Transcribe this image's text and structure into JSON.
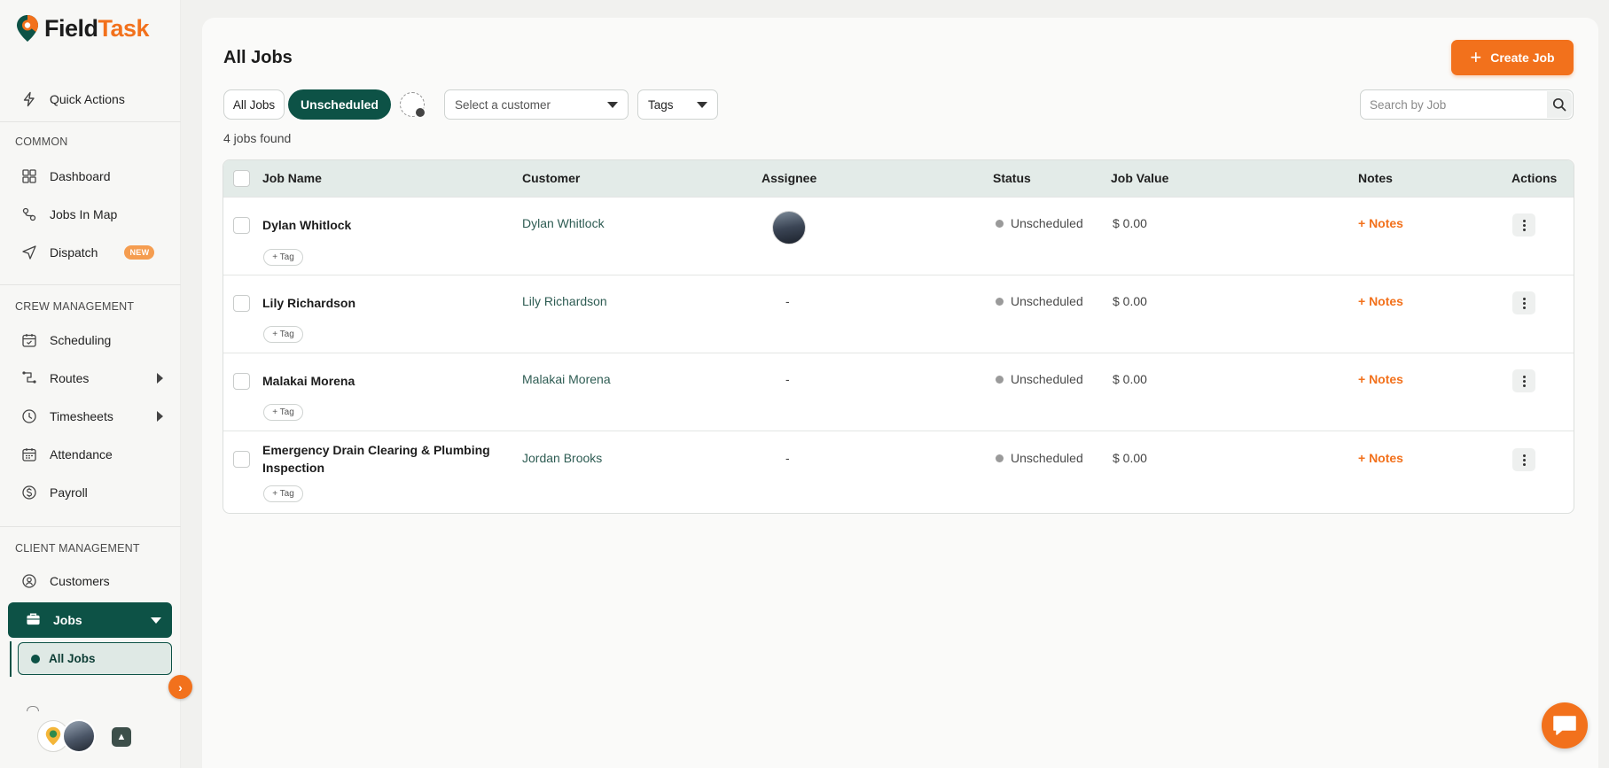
{
  "app": {
    "brand_first": "Field",
    "brand_second": "Task"
  },
  "sidebar": {
    "quick_actions": "Quick Actions",
    "sections": {
      "common": "COMMON",
      "crew": "CREW MANAGEMENT",
      "client": "CLIENT MANAGEMENT"
    },
    "items": {
      "dashboard": "Dashboard",
      "jobs_in_map": "Jobs In Map",
      "dispatch": "Dispatch",
      "dispatch_badge": "NEW",
      "scheduling": "Scheduling",
      "routes": "Routes",
      "timesheets": "Timesheets",
      "attendance": "Attendance",
      "payroll": "Payroll",
      "customers": "Customers",
      "jobs": "Jobs",
      "all_jobs": "All Jobs"
    }
  },
  "header": {
    "title": "All Jobs",
    "create_button": "Create Job"
  },
  "filters": {
    "all_jobs": "All Jobs",
    "unscheduled": "Unscheduled",
    "customer_select": "Select a customer",
    "tags_select": "Tags",
    "search_placeholder": "Search by Job"
  },
  "results_count": "4 jobs found",
  "table": {
    "columns": {
      "job_name": "Job Name",
      "customer": "Customer",
      "assignee": "Assignee",
      "status": "Status",
      "job_value": "Job Value",
      "notes": "Notes",
      "actions": "Actions"
    },
    "tag_button": "+ Tag",
    "notes_button": "+ Notes",
    "rows": [
      {
        "job_name": "Dylan Whitlock",
        "customer": "Dylan Whitlock",
        "assignee": "",
        "status": "Unscheduled",
        "value": "$ 0.00"
      },
      {
        "job_name": "Lily Richardson",
        "customer": "Lily Richardson",
        "assignee": "-",
        "status": "Unscheduled",
        "value": "$ 0.00"
      },
      {
        "job_name": "Malakai Morena",
        "customer": "Malakai Morena",
        "assignee": "-",
        "status": "Unscheduled",
        "value": "$ 0.00"
      },
      {
        "job_name": "Emergency Drain Clearing & Plumbing Inspection",
        "customer": "Jordan Brooks",
        "assignee": "-",
        "status": "Unscheduled",
        "value": "$ 0.00"
      }
    ]
  },
  "colors": {
    "accent": "#f2711c",
    "primary": "#0d5246",
    "table_header": "#e3ebe8"
  }
}
